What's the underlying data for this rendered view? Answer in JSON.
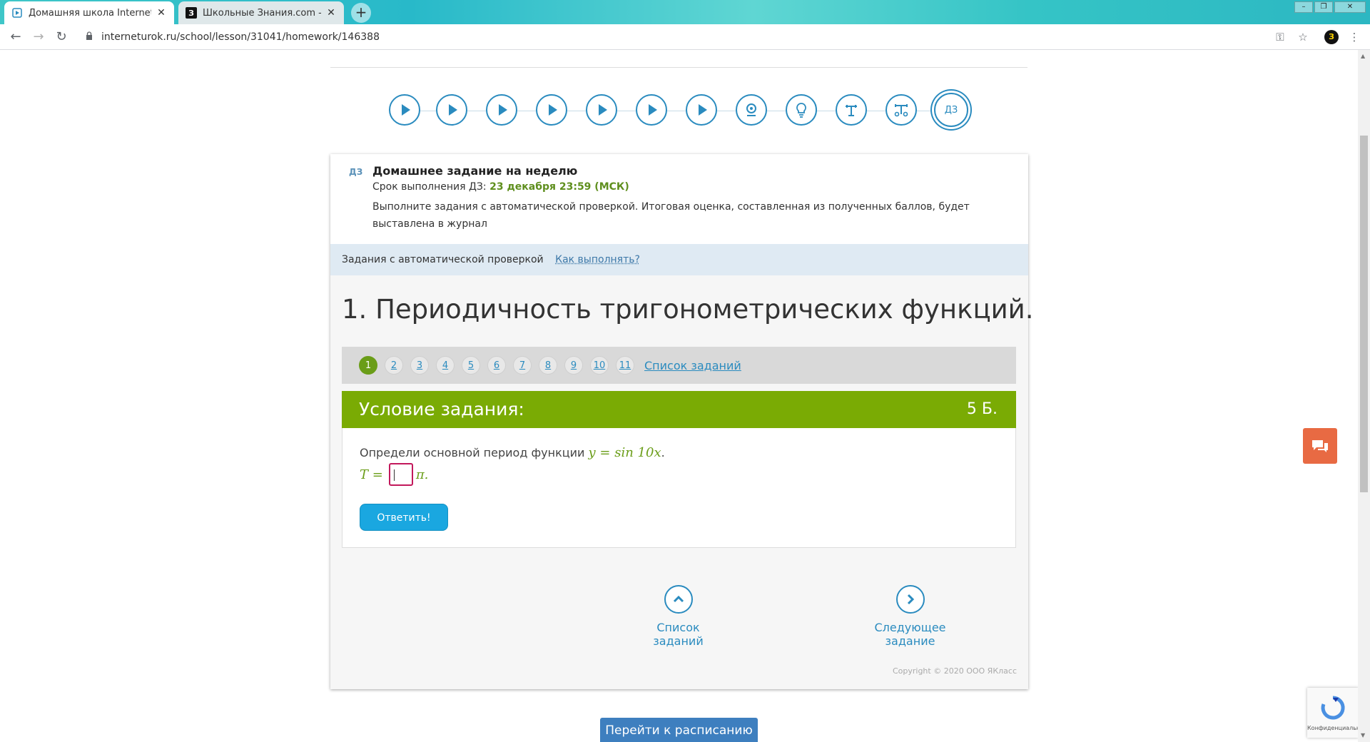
{
  "browser": {
    "tabs": [
      {
        "title": "Домашняя школа InternetUrok.r",
        "active": true
      },
      {
        "title": "Школьные Знания.com - Решае",
        "active": false
      }
    ],
    "new_tab": "+",
    "url": "interneturok.ru/school/lesson/31041/homework/146388",
    "profile_letter": "З"
  },
  "steps": [
    "play",
    "play",
    "play",
    "play",
    "play",
    "play",
    "play",
    "webcam",
    "lightbulb",
    "trainer",
    "trainer-advanced",
    "ДЗ"
  ],
  "homework": {
    "tag": "ДЗ",
    "title": "Домашнее задание на неделю",
    "deadline_label": "Срок выполнения ДЗ:",
    "deadline_value": "23 декабря 23:59 (МСК)",
    "description": "Выполните задания с автоматической проверкой. Итоговая оценка, составленная из полученных баллов, будет выставлена в журнал"
  },
  "auto_bar": {
    "label": "Задания с автоматической проверкой",
    "how_link": "Как выполнять?"
  },
  "task": {
    "title": "1. Периодичность тригонометрических функций.",
    "pages": [
      "1",
      "2",
      "3",
      "4",
      "5",
      "6",
      "7",
      "8",
      "9",
      "10",
      "11"
    ],
    "current_page": "1",
    "list_link": "Список заданий",
    "condition_label": "Условие задания:",
    "points": "5 Б.",
    "question_text": "Определи основной период функции",
    "question_formula": "y = sin 10x",
    "question_end": ".",
    "answer_prefix": "T =",
    "answer_suffix": "π.",
    "answer_value": "",
    "answer_button": "Ответить!"
  },
  "bottom_nav": {
    "list_label": "Список заданий",
    "next_label": "Следующее задание"
  },
  "copyright": "Copyright © 2020 ООО ЯКласс",
  "schedule_button": "Перейти к расписанию",
  "recaptcha_text": "Конфиденциальнос",
  "colors": {
    "accent_blue": "#2a8bbf",
    "green": "#7aab04",
    "button_blue": "#1aa7e0",
    "chat_orange": "#e86a43"
  }
}
